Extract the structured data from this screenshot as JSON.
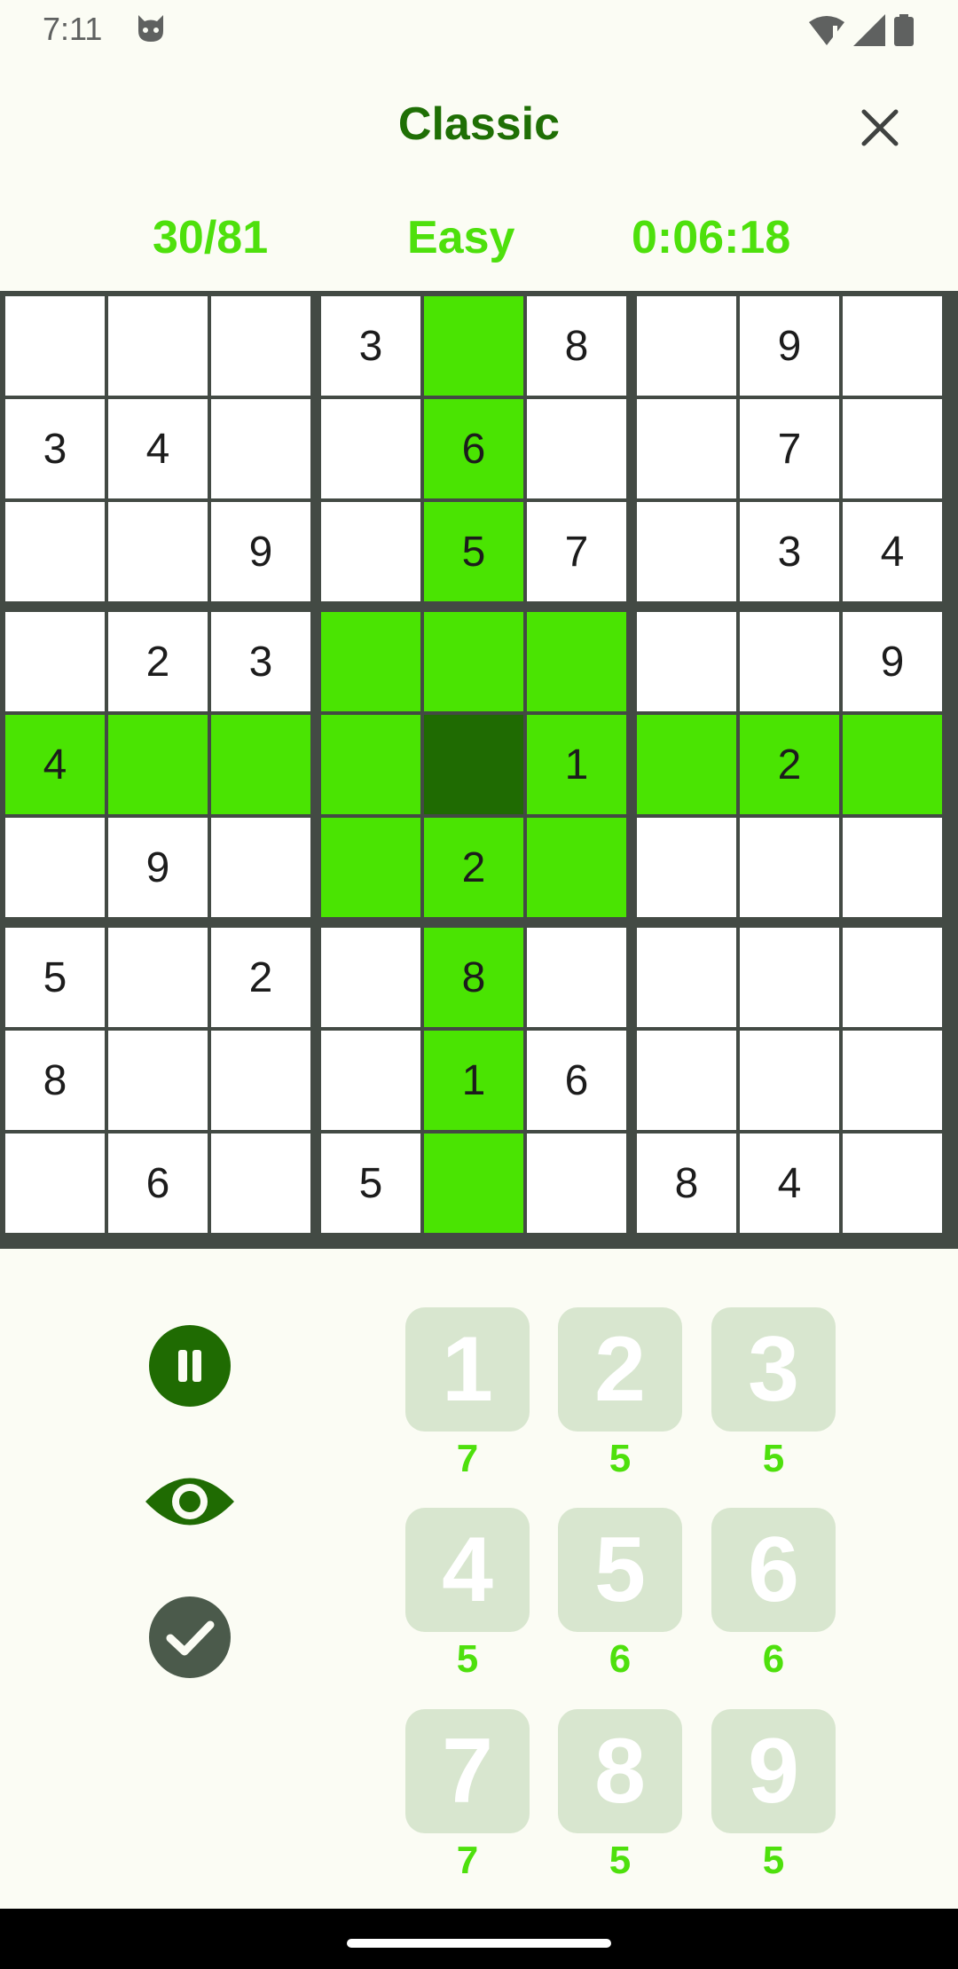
{
  "status_bar": {
    "time": "7:11"
  },
  "header": {
    "title": "Classic"
  },
  "info": {
    "filled": "30/81",
    "difficulty": "Easy",
    "timer": "0:06:18"
  },
  "board": [
    [
      "",
      "",
      "",
      "3",
      "",
      "8",
      "",
      "9",
      ""
    ],
    [
      "3",
      "4",
      "",
      "",
      "6",
      "",
      "",
      "7",
      ""
    ],
    [
      "",
      "",
      "9",
      "",
      "5",
      "7",
      "",
      "3",
      "4"
    ],
    [
      "",
      "2",
      "3",
      "",
      "",
      "",
      "",
      "",
      "9"
    ],
    [
      "4",
      "",
      "",
      "",
      "",
      "1",
      "",
      "2",
      ""
    ],
    [
      "",
      "9",
      "",
      "",
      "2",
      "",
      "",
      "",
      ""
    ],
    [
      "5",
      "",
      "2",
      "",
      "8",
      "",
      "",
      "",
      ""
    ],
    [
      "8",
      "",
      "",
      "",
      "1",
      "6",
      "",
      "",
      ""
    ],
    [
      "",
      "6",
      "",
      "5",
      "",
      "",
      "8",
      "4",
      ""
    ]
  ],
  "selected_cell": {
    "row": 5,
    "col": 5
  },
  "colors": {
    "accent_dark": "#1f6b02",
    "highlight": "#4ae402",
    "counter_text": "#4ee00c",
    "key_bg": "#d8e6cf",
    "grid_lines": "#434a44"
  },
  "controls": [
    "pause-icon",
    "eye-icon",
    "check-icon"
  ],
  "number_pad": [
    {
      "digit": "1",
      "count": "7"
    },
    {
      "digit": "2",
      "count": "5"
    },
    {
      "digit": "3",
      "count": "5"
    },
    {
      "digit": "4",
      "count": "5"
    },
    {
      "digit": "5",
      "count": "6"
    },
    {
      "digit": "6",
      "count": "6"
    },
    {
      "digit": "7",
      "count": "7"
    },
    {
      "digit": "8",
      "count": "5"
    },
    {
      "digit": "9",
      "count": "5"
    }
  ]
}
